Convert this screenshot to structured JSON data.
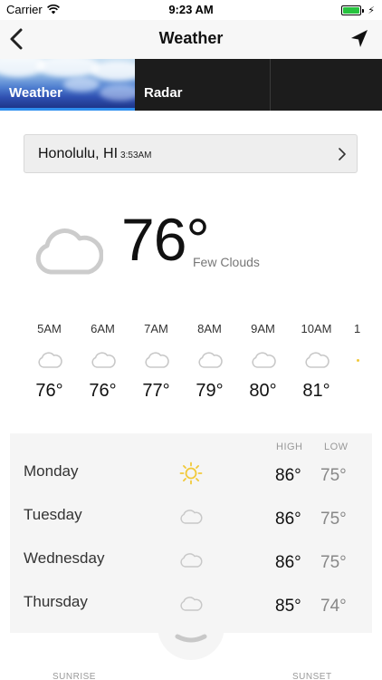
{
  "status_bar": {
    "carrier": "Carrier",
    "time": "9:23 AM"
  },
  "nav": {
    "title": "Weather",
    "back_icon": "chevron-left-icon",
    "location_icon": "location-arrow-icon"
  },
  "tabs": [
    {
      "label": "Weather",
      "active": true
    },
    {
      "label": "Radar",
      "active": false
    }
  ],
  "location": {
    "name": "Honolulu, HI",
    "local_time": "3:53AM"
  },
  "current": {
    "temp": "76°",
    "condition": "Few Clouds",
    "icon": "cloud-icon"
  },
  "hourly": [
    {
      "time": "5AM",
      "temp": "76°",
      "icon": "cloud-icon"
    },
    {
      "time": "6AM",
      "temp": "76°",
      "icon": "cloud-icon"
    },
    {
      "time": "7AM",
      "temp": "77°",
      "icon": "cloud-icon"
    },
    {
      "time": "8AM",
      "temp": "79°",
      "icon": "cloud-icon"
    },
    {
      "time": "9AM",
      "temp": "80°",
      "icon": "cloud-icon"
    },
    {
      "time": "10AM",
      "temp": "81°",
      "icon": "cloud-icon"
    }
  ],
  "hourly_partial": "1",
  "daily": {
    "high_label": "HIGH",
    "low_label": "LOW",
    "days": [
      {
        "day": "Monday",
        "high": "86°",
        "low": "75°",
        "icon": "sun-icon"
      },
      {
        "day": "Tuesday",
        "high": "86°",
        "low": "75°",
        "icon": "cloud-icon"
      },
      {
        "day": "Wednesday",
        "high": "86°",
        "low": "75°",
        "icon": "cloud-icon"
      },
      {
        "day": "Thursday",
        "high": "85°",
        "low": "74°",
        "icon": "cloud-icon"
      }
    ]
  },
  "bottom": {
    "sunrise_label": "SUNRISE",
    "sunset_label": "SUNSET"
  },
  "colors": {
    "accent": "#2f8fef",
    "sun": "#f1c93a",
    "battery": "#27c33f"
  }
}
